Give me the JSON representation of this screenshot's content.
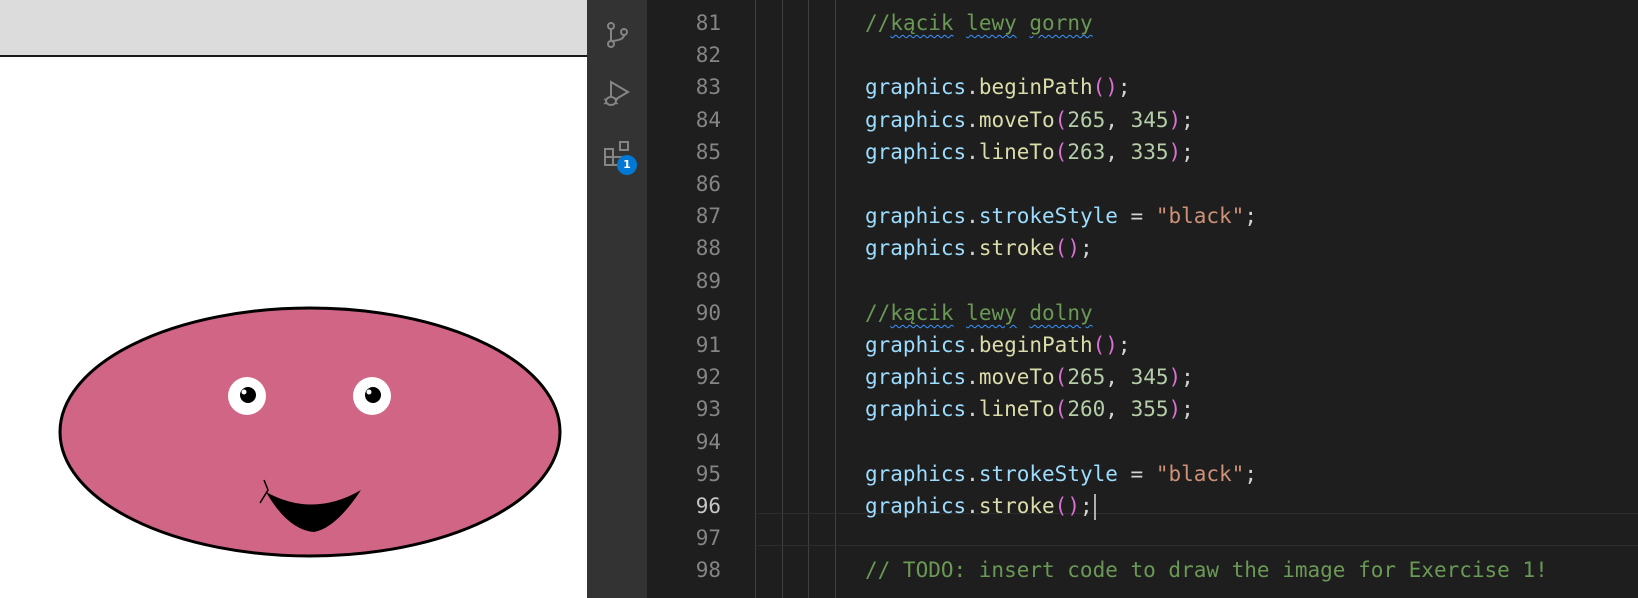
{
  "preview": {
    "colors": {
      "face": "#d06585",
      "outline": "#000000",
      "eye_white": "#ffffff",
      "pupil": "#000000"
    }
  },
  "activity_bar": {
    "icons": [
      "source-control-icon",
      "run-debug-icon",
      "extensions-icon"
    ],
    "extensions_badge": "1",
    "badge_color": "#0078d4"
  },
  "editor": {
    "lines": [
      {
        "number": "81",
        "kind": "comment",
        "comment": {
          "prefix": "//",
          "words": [
            "kącik",
            "lewy",
            "gorny"
          ]
        }
      },
      {
        "number": "82",
        "kind": "blank"
      },
      {
        "number": "83",
        "kind": "call",
        "obj": "graphics",
        "dot": ".",
        "method": "beginPath",
        "open": "(",
        "args": "",
        "close": ")",
        "end": ";"
      },
      {
        "number": "84",
        "kind": "call",
        "obj": "graphics",
        "dot": ".",
        "method": "moveTo",
        "open": "(",
        "a1": "265",
        "sep": ", ",
        "a2": "345",
        "close": ")",
        "end": ";"
      },
      {
        "number": "85",
        "kind": "call",
        "obj": "graphics",
        "dot": ".",
        "method": "lineTo",
        "open": "(",
        "a1": "263",
        "sep": ", ",
        "a2": "335",
        "close": ")",
        "end": ";"
      },
      {
        "number": "86",
        "kind": "blank"
      },
      {
        "number": "87",
        "kind": "assign",
        "obj": "graphics",
        "dot": ".",
        "prop": "strokeStyle",
        "op": " = ",
        "value": "\"black\"",
        "end": ";"
      },
      {
        "number": "88",
        "kind": "call",
        "obj": "graphics",
        "dot": ".",
        "method": "stroke",
        "open": "(",
        "args": "",
        "close": ")",
        "end": ";"
      },
      {
        "number": "89",
        "kind": "blank"
      },
      {
        "number": "90",
        "kind": "comment",
        "comment": {
          "prefix": "//",
          "words": [
            "kącik",
            "lewy",
            "dolny"
          ]
        }
      },
      {
        "number": "91",
        "kind": "call",
        "obj": "graphics",
        "dot": ".",
        "method": "beginPath",
        "open": "(",
        "args": "",
        "close": ")",
        "end": ";"
      },
      {
        "number": "92",
        "kind": "call",
        "obj": "graphics",
        "dot": ".",
        "method": "moveTo",
        "open": "(",
        "a1": "265",
        "sep": ", ",
        "a2": "345",
        "close": ")",
        "end": ";"
      },
      {
        "number": "93",
        "kind": "call",
        "obj": "graphics",
        "dot": ".",
        "method": "lineTo",
        "open": "(",
        "a1": "260",
        "sep": ", ",
        "a2": "355",
        "close": ")",
        "end": ";"
      },
      {
        "number": "94",
        "kind": "blank"
      },
      {
        "number": "95",
        "kind": "assign",
        "obj": "graphics",
        "dot": ".",
        "prop": "strokeStyle",
        "op": " = ",
        "value": "\"black\"",
        "end": ";"
      },
      {
        "number": "96",
        "kind": "call",
        "obj": "graphics",
        "dot": ".",
        "method": "stroke",
        "open": "(",
        "args": "",
        "close": ")",
        "end": ";",
        "active": true
      },
      {
        "number": "97",
        "kind": "blank"
      },
      {
        "number": "98",
        "kind": "todo",
        "text": "// TODO: insert code to draw the image for Exercise 1!"
      }
    ]
  }
}
